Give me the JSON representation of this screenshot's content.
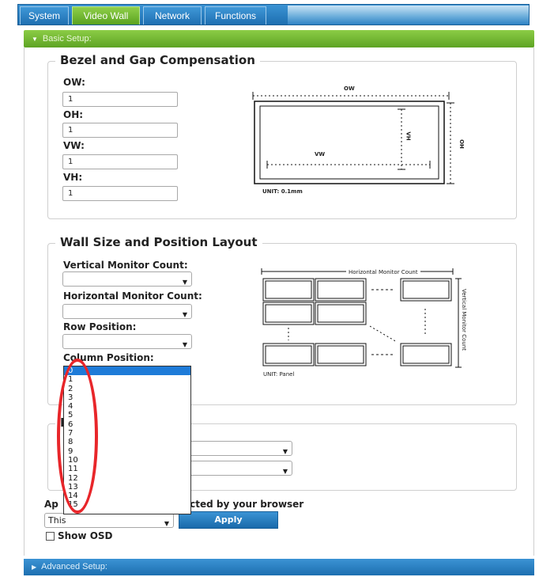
{
  "tabs": [
    {
      "label": "System",
      "active": false
    },
    {
      "label": "Video Wall",
      "active": true
    },
    {
      "label": "Network",
      "active": false
    },
    {
      "label": "Functions",
      "active": false
    }
  ],
  "basic_setup": {
    "label": "Basic Setup:"
  },
  "bezel": {
    "title": "Bezel and Gap Compensation",
    "fields": [
      {
        "label": "OW:",
        "value": "1"
      },
      {
        "label": "OH:",
        "value": "1"
      },
      {
        "label": "VW:",
        "value": "1"
      },
      {
        "label": "VH:",
        "value": "1"
      }
    ],
    "diagram": {
      "ow": "OW",
      "oh": "OH",
      "vw": "VW",
      "vh": "VH",
      "unit": "UNIT: 0.1mm"
    }
  },
  "wall": {
    "title": "Wall Size and Position Layout",
    "fields": [
      {
        "label": "Vertical Monitor Count:",
        "value": ""
      },
      {
        "label": "Horizontal Monitor Count:",
        "value": ""
      },
      {
        "label": "Row Position:",
        "value": ""
      },
      {
        "label": "Column Position:",
        "value": ""
      }
    ],
    "diagram": {
      "h_count": "Horizontal Monitor Count",
      "v_count": "Vertical Monitor Count",
      "unit": "UNIT: Panel"
    }
  },
  "dropdown_options": [
    "0",
    "1",
    "2",
    "3",
    "4",
    "5",
    "6",
    "7",
    "8",
    "9",
    "10",
    "11",
    "12",
    "13",
    "14",
    "15"
  ],
  "dropdown_selected_index": 0,
  "apply_section": {
    "label_left": "Ap",
    "label_right": "ected by your browser",
    "select_value": "This",
    "apply_label": "Apply",
    "show_osd_label": "Show OSD",
    "show_osd_checked": false
  },
  "section3_label_fragment": "F",
  "section3_select1_fragment": "o",
  "advanced_setup": {
    "label": "Advanced Setup:"
  },
  "colors": {
    "tab_blue": "#1d6fb0",
    "tab_active_green": "#5aa21f",
    "dropdown_highlight": "#1e7bd8",
    "annotation_red": "#e8262a"
  }
}
